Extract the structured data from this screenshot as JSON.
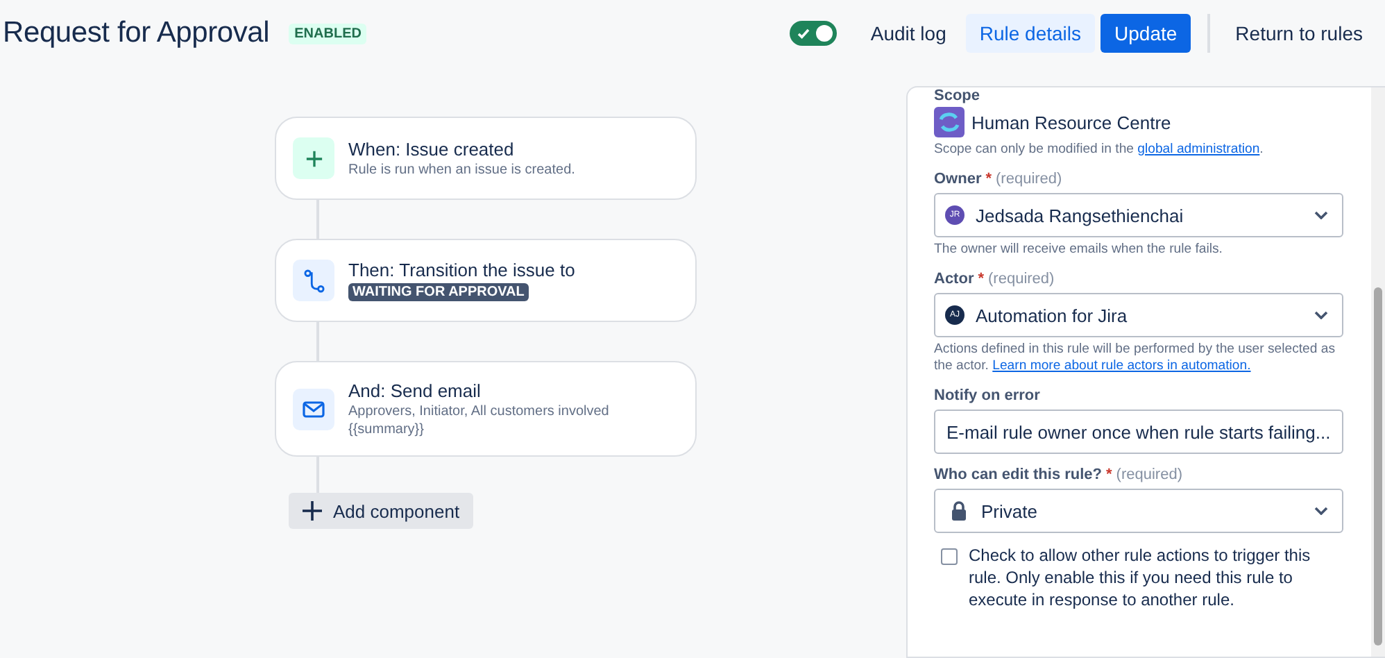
{
  "header": {
    "title": "Request for Approval",
    "status": "ENABLED",
    "toggle": {
      "on": true
    },
    "audit_log": "Audit log",
    "rule_details": {
      "label": "Rule details",
      "selected": true
    },
    "update": "Update",
    "return": "Return to rules"
  },
  "steps": [
    {
      "kind": "trigger",
      "title": "When: Issue created",
      "description": [
        "Rule is run when an issue is created."
      ]
    },
    {
      "kind": "transition",
      "title": "Then: Transition the issue to",
      "lozenge": "WAITING FOR APPROVAL"
    },
    {
      "kind": "email",
      "title": "And: Send email",
      "description": [
        "Approvers, Initiator, All customers involved",
        "{{summary}}"
      ]
    }
  ],
  "add_component": "Add component",
  "details": {
    "scope_label": "Scope",
    "scope_name": "Human Resource Centre",
    "scope_note": "Scope can only be modified in the",
    "scope_link": "global administration",
    "scope_note_end": ".",
    "required_mark": "*",
    "owner": {
      "label": "Owner",
      "required": "(required)",
      "value": "Jedsada Rangsethienchai",
      "initials": "JR",
      "help": "The owner will receive emails when the rule fails."
    },
    "actor": {
      "label": "Actor",
      "required": "(required)",
      "value": "Automation for Jira",
      "initials": "AJ",
      "help": "Actions defined in this rule will be performed by the user selected as the actor.",
      "link": "Learn more about rule actors in automation."
    },
    "notify": {
      "label": "Notify on error",
      "value": "E-mail rule owner once when rule starts failing..."
    },
    "editors": {
      "label": "Who can edit this rule?",
      "required": "(required)",
      "value": "Private"
    },
    "allow_trigger": {
      "checked": false,
      "label": "Check to allow other rule actions to trigger this rule. Only enable this if you need this rule to execute in response to another rule."
    }
  }
}
